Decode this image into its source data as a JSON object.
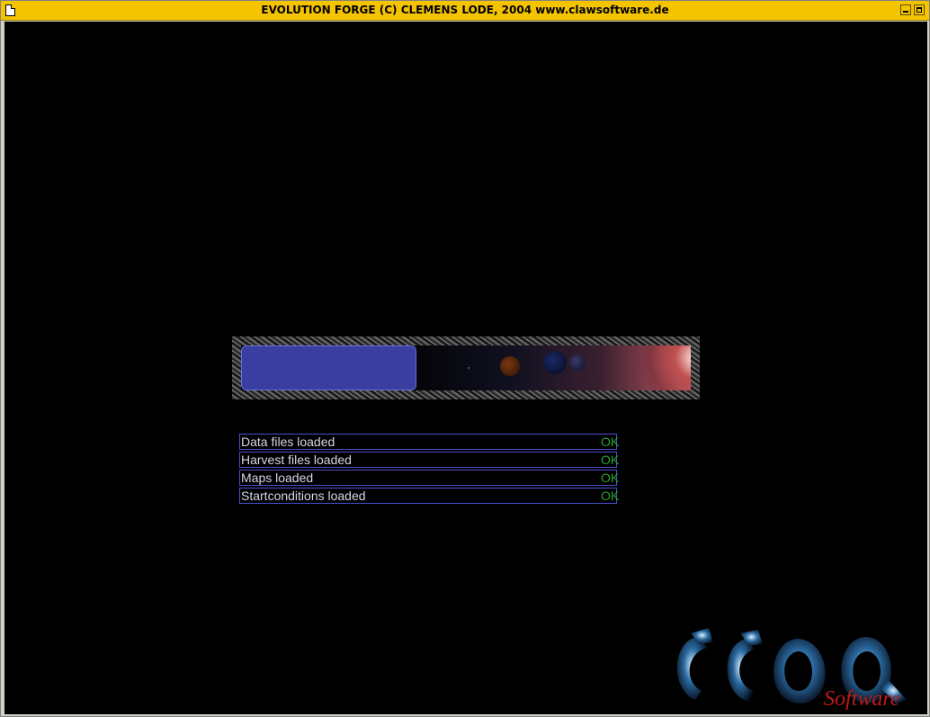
{
  "window": {
    "title": "EVOLUTION FORGE (C) CLEMENS LODE, 2004 www.clawsoftware.de"
  },
  "progress": {
    "fraction": 0.39
  },
  "status_items": [
    {
      "label": "Data files loaded",
      "status": "OK"
    },
    {
      "label": "Harvest files loaded",
      "status": "OK"
    },
    {
      "label": "Maps loaded",
      "status": "OK"
    },
    {
      "label": "Startconditions loaded",
      "status": "OK"
    }
  ],
  "logo": {
    "text": "Software"
  },
  "colors": {
    "titlebar": "#f5c400",
    "progress_fill": "#3a3ea0",
    "ok_text": "#2aa02a",
    "row_border": "#4a4ed0"
  }
}
